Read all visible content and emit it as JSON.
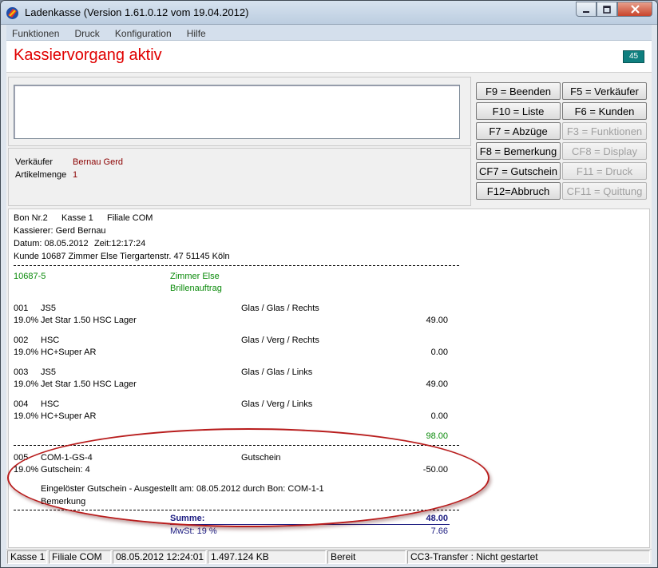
{
  "window": {
    "title": "Ladenkasse (Version 1.61.0.12 vom 19.04.2012)"
  },
  "menu": [
    "Funktionen",
    "Druck",
    "Konfiguration",
    "Hilfe"
  ],
  "status_header": {
    "title": "Kassiervorgang aktiv",
    "counter": "45"
  },
  "seller": {
    "verkaeufer_label": "Verkäufer",
    "verkaeufer_value": "Bernau Gerd",
    "artikelmenge_label": "Artikelmenge",
    "artikelmenge_value": "1"
  },
  "fkeys": [
    {
      "label": "F9 = Beenden",
      "enabled": true
    },
    {
      "label": "F5 = Verkäufer",
      "enabled": true
    },
    {
      "label": "F10 = Liste",
      "enabled": true
    },
    {
      "label": "F6 = Kunden",
      "enabled": true
    },
    {
      "label": "F7 = Abzüge",
      "enabled": true
    },
    {
      "label": "F3 = Funktionen",
      "enabled": false
    },
    {
      "label": "F8 = Bemerkung",
      "enabled": true
    },
    {
      "label": "CF8 = Display",
      "enabled": false
    },
    {
      "label": "CF7 = Gutschein",
      "enabled": true
    },
    {
      "label": "F11 = Druck",
      "enabled": false
    },
    {
      "label": "F12=Abbruch",
      "enabled": true
    },
    {
      "label": "CF11 = Quittung",
      "enabled": false
    }
  ],
  "receipt": {
    "header": {
      "bon": "Bon Nr.2",
      "kasse": "Kasse 1",
      "filiale": "Filiale COM",
      "kassierer": "Kassierer: Gerd Bernau",
      "datum": "Datum: 08.05.2012",
      "zeit": "Zeit:12:17:24",
      "kunde": "Kunde 10687  Zimmer Else  Tiergartenstr. 47  51145 Köln"
    },
    "order": {
      "number": "10687-5",
      "name": "Zimmer Else",
      "type": "Brillenauftrag"
    },
    "items": [
      {
        "pos": "001",
        "code": "JS5",
        "category": "Glas / Glas / Rechts",
        "tax": "19.0%",
        "description": "Jet Star 1.50 HSC Lager",
        "price": "49.00"
      },
      {
        "pos": "002",
        "code": "HSC",
        "category": "Glas / Verg / Rechts",
        "tax": "19.0%",
        "description": "HC+Super AR",
        "price": "0.00"
      },
      {
        "pos": "003",
        "code": "JS5",
        "category": "Glas / Glas / Links",
        "tax": "19.0%",
        "description": "Jet Star 1.50 HSC Lager",
        "price": "49.00"
      },
      {
        "pos": "004",
        "code": "HSC",
        "category": "Glas / Verg / Links",
        "tax": "19.0%",
        "description": "HC+Super AR",
        "price": "0.00"
      }
    ],
    "subtotal": "98.00",
    "voucher": {
      "pos": "005",
      "code": "COM-1-GS-4",
      "category": "Gutschein",
      "tax": "19.0%",
      "description": "Gutschein: 4",
      "price": "-50.00",
      "note": "Eingelöster Gutschein - Ausgestellt am: 08.05.2012 durch Bon: COM-1-1",
      "remark": "Bemerkung"
    },
    "summe_label": "Summe:",
    "summe_value": "48.00",
    "mwst_label": "MwSt: 19 %",
    "mwst_value": "7.66"
  },
  "statusbar": {
    "kasse": "Kasse 1",
    "filiale": "Filiale COM",
    "datetime": "08.05.2012   12:24:01",
    "memory": "1.497.124 KB",
    "state": "Bereit",
    "transfer": "CC3-Transfer : Nicht gestartet"
  }
}
